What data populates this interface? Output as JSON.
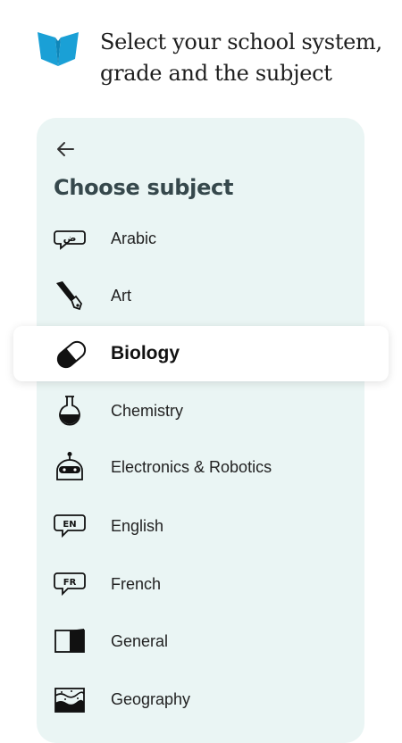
{
  "header": {
    "logo_icon": "open-book-icon",
    "brand_color": "#1aa0d6",
    "headline": "Select your school system, grade and the subject"
  },
  "panel": {
    "background": "#eaf5f4",
    "back_icon": "arrow-left-icon",
    "title": "Choose subject"
  },
  "subjects": [
    {
      "label": "Arabic",
      "icon": "arabic-letter-bubble-icon",
      "selected": false
    },
    {
      "label": "Art",
      "icon": "paintbrush-icon",
      "selected": false
    },
    {
      "label": "Biology",
      "icon": "capsule-icon",
      "selected": true
    },
    {
      "label": "Chemistry",
      "icon": "flask-icon",
      "selected": false
    },
    {
      "label": "Electronics & Robotics",
      "icon": "robot-icon",
      "selected": false
    },
    {
      "label": "English",
      "icon": "en-bubble-icon",
      "selected": false
    },
    {
      "label": "French",
      "icon": "fr-bubble-icon",
      "selected": false
    },
    {
      "label": "General",
      "icon": "half-book-icon",
      "selected": false
    },
    {
      "label": "Geography",
      "icon": "terrain-layers-icon",
      "selected": false
    }
  ]
}
